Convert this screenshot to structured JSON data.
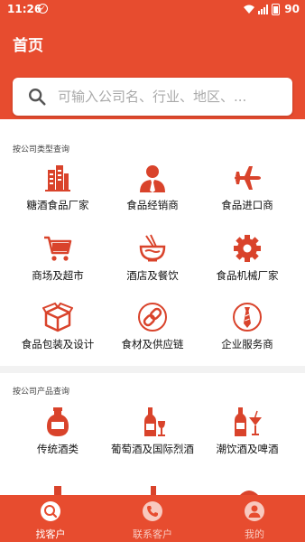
{
  "status": {
    "time": "11:26",
    "battery": "90"
  },
  "header": {
    "title": "首页"
  },
  "search": {
    "placeholder": "可输入公司名、行业、地区、..."
  },
  "section_type": {
    "title": "按公司类型查询",
    "items": [
      {
        "label": "糖酒食品厂家",
        "icon": "building-icon"
      },
      {
        "label": "食品经销商",
        "icon": "businessman-icon"
      },
      {
        "label": "食品进口商",
        "icon": "airplane-icon"
      },
      {
        "label": "商场及超市",
        "icon": "shopping-cart-icon"
      },
      {
        "label": "酒店及餐饮",
        "icon": "noodle-bowl-icon"
      },
      {
        "label": "食品机械厂家",
        "icon": "gear-icon"
      },
      {
        "label": "食品包装及设计",
        "icon": "package-box-icon"
      },
      {
        "label": "食材及供应链",
        "icon": "chain-link-icon"
      },
      {
        "label": "企业服务商",
        "icon": "necktie-icon"
      }
    ]
  },
  "section_product": {
    "title": "按公司产品查询",
    "items": [
      {
        "label": "传统酒类",
        "icon": "liquor-jar-icon"
      },
      {
        "label": "葡萄酒及国际烈酒",
        "icon": "wine-bottle-glass-icon"
      },
      {
        "label": "潮饮酒及啤酒",
        "icon": "cocktail-bottle-icon"
      }
    ]
  },
  "tabbar": {
    "items": [
      {
        "label": "找客户",
        "icon": "search-tab-icon",
        "active": true
      },
      {
        "label": "联系客户",
        "icon": "phone-icon",
        "active": false
      },
      {
        "label": "我的",
        "icon": "user-icon",
        "active": false
      }
    ]
  },
  "colors": {
    "accent": "#e74c2f",
    "icon": "#d9432b",
    "tab_inactive": "#f8c9bf"
  }
}
